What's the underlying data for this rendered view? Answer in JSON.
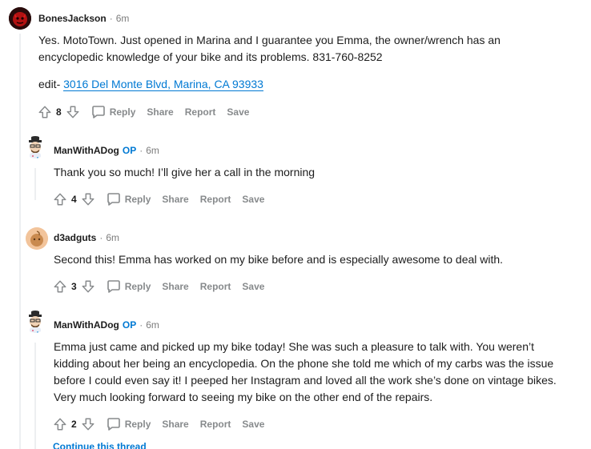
{
  "comments": [
    {
      "author": "BonesJackson",
      "op_badge": "",
      "time": "6m",
      "paragraphs": [
        "Yes. MotoTown. Just opened in Marina and I guarantee you Emma, the owner/wrench has an encyclopedic knowledge of your bike and its problems. 831-760-8252"
      ],
      "edit_prefix": "edit-",
      "edit_link": "3016 Del Monte Blvd, Marina, CA 93933",
      "score": "8"
    },
    {
      "author": "ManWithADog",
      "op_badge": "OP",
      "time": "6m",
      "paragraphs": [
        "Thank you so much! I’ll give her a call in the morning"
      ],
      "score": "4"
    },
    {
      "author": "d3adguts",
      "op_badge": "",
      "time": "6m",
      "paragraphs": [
        "Second this! Emma has worked on my bike before and is especially awesome to deal with."
      ],
      "score": "3"
    },
    {
      "author": "ManWithADog",
      "op_badge": "OP",
      "time": "6m",
      "paragraphs": [
        "Emma just came and picked up my bike today! She was such a pleasure to talk with. You weren’t kidding about her being an encyclopedia. On the phone she told me which of my carbs was the issue before I could even say it! I peeped her Instagram and loved all the work she’s done on vintage bikes. Very much looking forward to seeing my bike on the other end of the repairs."
      ],
      "score": "2"
    }
  ],
  "actions": {
    "reply": "Reply",
    "share": "Share",
    "report": "Report",
    "save": "Save"
  },
  "continue_thread": "Continue this thread",
  "icons": [
    "upvote-icon",
    "downvote-icon",
    "comment-icon"
  ],
  "colors": {
    "link": "#0079d3",
    "op": "#0079d3",
    "muted": "#878a8c",
    "text": "#1c1c1c"
  }
}
